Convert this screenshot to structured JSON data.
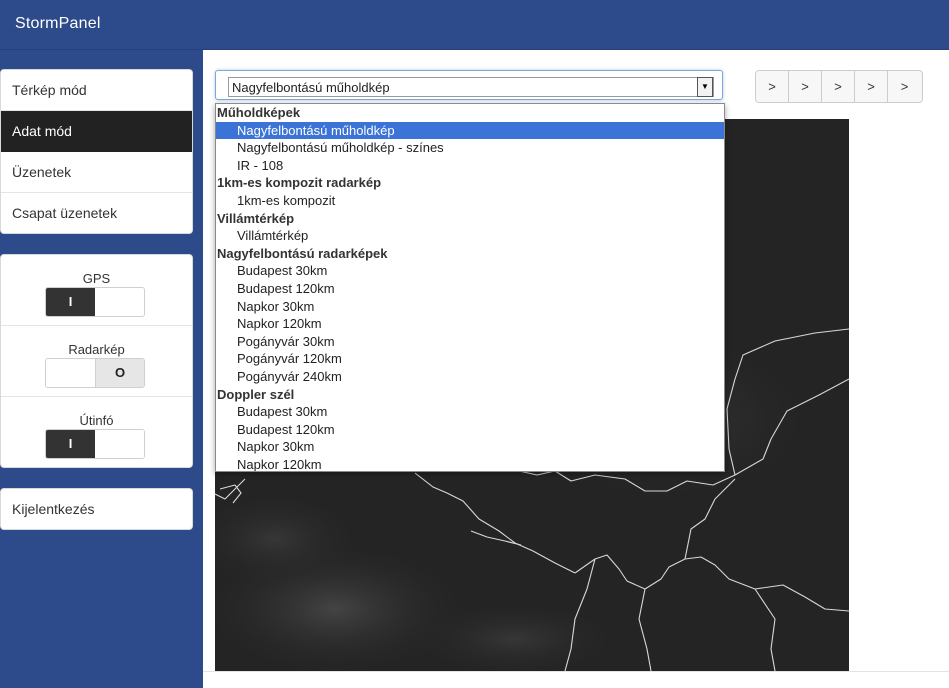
{
  "app": {
    "brand": "StormPanel"
  },
  "sidebar": {
    "nav": [
      {
        "label": "Térkép mód",
        "active": false
      },
      {
        "label": "Adat mód",
        "active": true
      },
      {
        "label": "Üzenetek",
        "active": false
      },
      {
        "label": "Csapat üzenetek",
        "active": false
      }
    ],
    "toggles": [
      {
        "label": "GPS",
        "state_text": "I"
      },
      {
        "label": "Radarkép",
        "state_text": "O"
      },
      {
        "label": "Útinfó",
        "state_text": "I"
      }
    ],
    "logout_label": "Kijelentkezés"
  },
  "main": {
    "select_value": "Nagyfelbontású műholdkép",
    "nav_buttons": [
      ">",
      ">",
      ">",
      ">",
      ">"
    ],
    "dropdown": {
      "groups": [
        {
          "label": "Műholdképek",
          "options": [
            "Nagyfelbontású műholdkép",
            "Nagyfelbontású műholdkép - színes",
            "IR - 108"
          ]
        },
        {
          "label": "1km-es kompozit radarkép",
          "options": [
            "1km-es kompozit"
          ]
        },
        {
          "label": "Villámtérkép",
          "options": [
            "Villámtérkép"
          ]
        },
        {
          "label": "Nagyfelbontású radarképek",
          "options": [
            "Budapest 30km",
            "Budapest 120km",
            "Napkor 30km",
            "Napkor 120km",
            "Pogányvár 30km",
            "Pogányvár 120km",
            "Pogányvár 240km"
          ]
        },
        {
          "label": "Doppler szél",
          "options": [
            "Budapest 30km",
            "Budapest 120km",
            "Napkor 30km",
            "Napkor 120km"
          ]
        }
      ],
      "selected_option": "Nagyfelbontású műholdkép"
    }
  },
  "colors": {
    "navbar": "#2d4a8a",
    "active_nav": "#222222",
    "dropdown_highlight": "#3b74d6",
    "map_background": "#242424"
  }
}
